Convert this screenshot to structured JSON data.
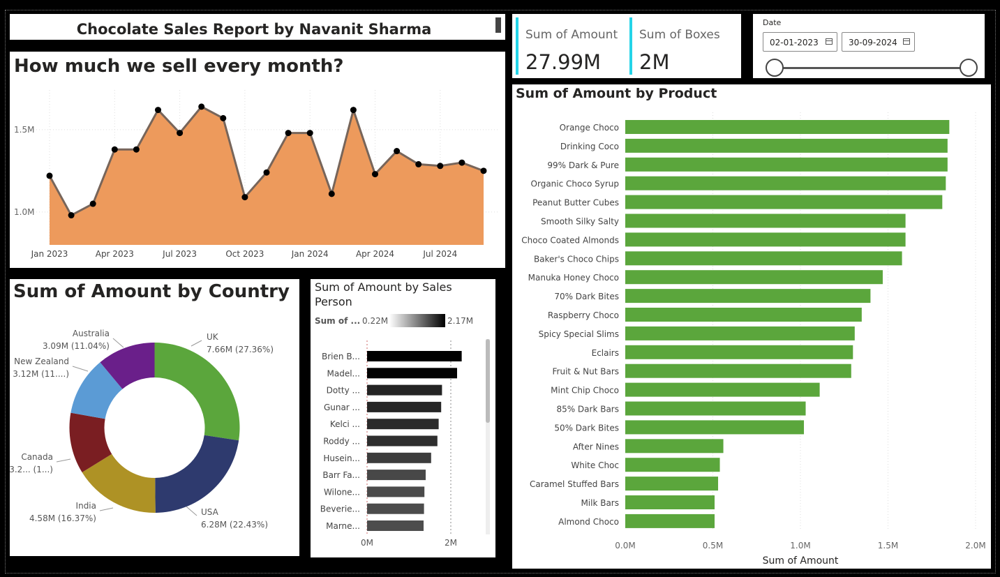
{
  "report_title": "Chocolate Sales Report by Navanit Sharma",
  "kpis": [
    {
      "label": "Sum of Amount",
      "value": "27.99M"
    },
    {
      "label": "Sum of Boxes",
      "value": "2M"
    }
  ],
  "date_slicer": {
    "label": "Date",
    "start": "02-01-2023",
    "end": "30-09-2024"
  },
  "colors": {
    "accent": "#24D4E8",
    "area": "#ED9A5C",
    "bar_green": "#5BA63C"
  },
  "chart_data": [
    {
      "id": "monthly",
      "type": "area",
      "title": "How much we sell every month?",
      "x": [
        "2023-01",
        "2023-02",
        "2023-03",
        "2023-04",
        "2023-05",
        "2023-06",
        "2023-07",
        "2023-08",
        "2023-09",
        "2023-10",
        "2023-11",
        "2023-12",
        "2024-01",
        "2024-02",
        "2024-03",
        "2024-04",
        "2024-05",
        "2024-06",
        "2024-07",
        "2024-08",
        "2024-09"
      ],
      "values": [
        1.22,
        0.98,
        1.05,
        1.38,
        1.38,
        1.62,
        1.48,
        1.64,
        1.57,
        1.09,
        1.24,
        1.48,
        1.48,
        1.11,
        1.62,
        1.23,
        1.37,
        1.29,
        1.28,
        1.3,
        1.25
      ],
      "xticks": [
        {
          "x": "2023-01",
          "label": "Jan 2023"
        },
        {
          "x": "2023-04",
          "label": "Apr 2023"
        },
        {
          "x": "2023-07",
          "label": "Jul 2023"
        },
        {
          "x": "2023-10",
          "label": "Oct 2023"
        },
        {
          "x": "2024-01",
          "label": "Jan 2024"
        },
        {
          "x": "2024-04",
          "label": "Apr 2024"
        },
        {
          "x": "2024-07",
          "label": "Jul 2024"
        }
      ],
      "yticks": [
        {
          "v": 1.5,
          "label": "1.5M"
        },
        {
          "v": 1.0,
          "label": "1.0M"
        }
      ],
      "ylim": [
        0.8,
        1.72
      ],
      "grid": true
    },
    {
      "id": "country",
      "type": "pie",
      "title": "Sum of Amount by Country",
      "slices": [
        {
          "name": "UK",
          "value": 7.66,
          "label_line1": "UK",
          "label_line2": "7.66M (27.36%)",
          "color": "#5BA63C"
        },
        {
          "name": "USA",
          "value": 6.28,
          "label_line1": "USA",
          "label_line2": "6.28M (22.43%)",
          "color": "#2E3A6E"
        },
        {
          "name": "India",
          "value": 4.58,
          "label_line1": "India",
          "label_line2": "4.58M (16.37%)",
          "color": "#AE9225"
        },
        {
          "name": "Canada",
          "value": 3.24,
          "label_line1": "Canada",
          "label_line2": "3.2... (1...)",
          "color": "#7A1E22"
        },
        {
          "name": "New Zealand",
          "value": 3.12,
          "label_line1": "New Zealand",
          "label_line2": "3.12M (11....)",
          "color": "#5B9BD5"
        },
        {
          "name": "Australia",
          "value": 3.09,
          "label_line1": "Australia",
          "label_line2": "3.09M (11.04%)",
          "color": "#6A1F8A"
        }
      ]
    },
    {
      "id": "salesperson",
      "type": "bar",
      "title": "Sum of Amount by Sales Person",
      "legend": {
        "label": "Sum of ...",
        "min": "0.22M",
        "max": "2.17M"
      },
      "categories": [
        "Brien B...",
        "Madel...",
        "Dotty ...",
        "Gunar ...",
        "Kelci ...",
        "Roddy ...",
        "Husein...",
        "Barr Fa...",
        "Wilone...",
        "Beverie...",
        "Marne..."
      ],
      "values": [
        2.26,
        2.15,
        1.79,
        1.77,
        1.71,
        1.68,
        1.53,
        1.4,
        1.37,
        1.36,
        1.35
      ],
      "xticks": [
        {
          "v": 0,
          "label": "0M"
        },
        {
          "v": 2,
          "label": "2M"
        }
      ],
      "xlim": [
        0,
        2.85
      ]
    },
    {
      "id": "product",
      "type": "bar",
      "title": "Sum of Amount by Product",
      "xlabel": "Sum of Amount",
      "categories": [
        "Orange Choco",
        "Drinking Coco",
        "99% Dark & Pure",
        "Organic Choco Syrup",
        "Peanut Butter Cubes",
        "Smooth Silky Salty",
        "Choco Coated Almonds",
        "Baker's Choco Chips",
        "Manuka Honey Choco",
        "70% Dark Bites",
        "Raspberry Choco",
        "Spicy Special Slims",
        "Eclairs",
        "Fruit & Nut Bars",
        "Mint Chip Choco",
        "85% Dark Bars",
        "50% Dark Bites",
        "After Nines",
        "White Choc",
        "Caramel Stuffed Bars",
        "Milk Bars",
        "Almond Choco"
      ],
      "values": [
        1.85,
        1.84,
        1.84,
        1.83,
        1.81,
        1.6,
        1.6,
        1.58,
        1.47,
        1.4,
        1.35,
        1.31,
        1.3,
        1.29,
        1.11,
        1.03,
        1.02,
        0.56,
        0.54,
        0.53,
        0.51,
        0.51
      ],
      "xticks": [
        {
          "v": 0,
          "label": "0.0M"
        },
        {
          "v": 0.5,
          "label": "0.5M"
        },
        {
          "v": 1.0,
          "label": "1.0M"
        },
        {
          "v": 1.5,
          "label": "1.5M"
        },
        {
          "v": 2.0,
          "label": "2.0M"
        }
      ],
      "xlim": [
        0,
        2.0
      ]
    }
  ]
}
